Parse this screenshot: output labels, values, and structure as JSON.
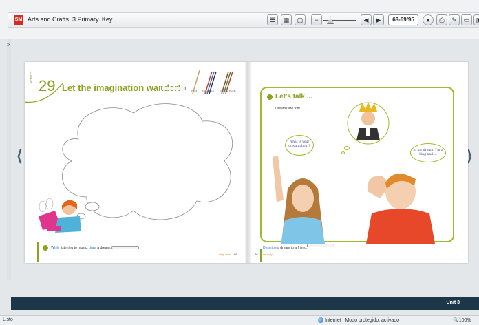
{
  "window": {
    "title": "Arts and Crafts. 3 Primary. Key",
    "logo_text": "SM"
  },
  "toolbar": {
    "page_indicator": "68-69/95",
    "collapse_glyph": "»"
  },
  "left_page": {
    "activity_label": "ACTIVITY",
    "activity_number": "29",
    "title": "Let the imagination wander!",
    "tool_labels": [
      "Pencil",
      "Felt-tip Pens",
      "Coloured Pencils"
    ],
    "footer": {
      "prefix": "While",
      "text1": " listening to music, ",
      "verb": "draw",
      "text2": " a dream."
    },
    "page_name": "sixty-nine",
    "page_number": "69"
  },
  "right_page": {
    "talk_title": "Let's talk ...",
    "talk_subtitle": "Dreams are fun!",
    "girl_bubble": "What is your dream about?",
    "boy_bubble": "In my dream, I'm a king and ...",
    "footer": {
      "verb": "Describe",
      "text": " a dream to a friend."
    },
    "page_number": "70",
    "page_name": "seventy"
  },
  "bottom": {
    "unit_label": "Unit 3"
  },
  "status": {
    "left": "Listo",
    "middle": "Internet | Modo protegido: activado",
    "zoom": "100%"
  },
  "colors": {
    "accent_green": "#8aa21f",
    "bottom_bar": "#1d3748",
    "highlight_blue": "#2e78c4"
  }
}
